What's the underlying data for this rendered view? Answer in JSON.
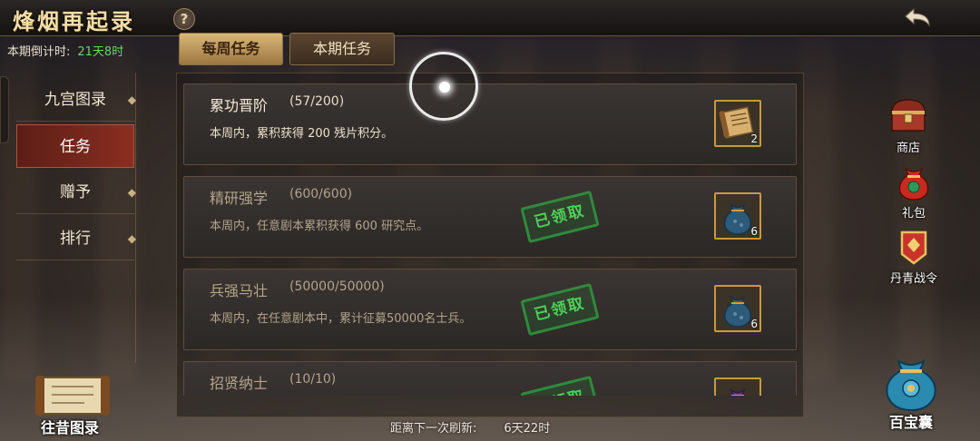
{
  "header": {
    "title": "烽烟再起录",
    "help_label": "?"
  },
  "countdown": {
    "label": "本期倒计时:",
    "value": "21天8时"
  },
  "sidebar": {
    "items": [
      {
        "label": "九宫图录",
        "active": false
      },
      {
        "label": "任务",
        "active": true
      },
      {
        "label": "赠予",
        "active": false
      },
      {
        "label": "排行",
        "active": false
      }
    ]
  },
  "tabs": [
    {
      "label": "每周任务",
      "selected": true
    },
    {
      "label": "本期任务",
      "selected": false
    }
  ],
  "quests": [
    {
      "name": "累功晋阶",
      "progress": "(57/200)",
      "desc": "本周内，累积获得 200 残片积分。",
      "claimed": false,
      "reward_icon": "scroll-icon",
      "reward_count": "2"
    },
    {
      "name": "精研强学",
      "progress": "(600/600)",
      "desc": "本周内，任意剧本累积获得 600 研究点。",
      "claimed": true,
      "reward_icon": "pouch-icon",
      "reward_count": "6"
    },
    {
      "name": "兵强马壮",
      "progress": "(50000/50000)",
      "desc": "本周内，在任意剧本中，累计征募50000名士兵。",
      "claimed": true,
      "reward_icon": "pouch-icon",
      "reward_count": "6"
    },
    {
      "name": "招贤纳士",
      "progress": "(10/10)",
      "desc": "",
      "claimed": true,
      "reward_icon": "purple-pouch-icon",
      "reward_count": ""
    }
  ],
  "stamp_label": "已领取",
  "refresh": {
    "label": "距离下一次刷新:",
    "value": "6天22时"
  },
  "right_menu": [
    {
      "label": "商店",
      "icon": "treasure-chest-icon"
    },
    {
      "label": "礼包",
      "icon": "gift-bag-icon"
    },
    {
      "label": "丹青战令",
      "icon": "battle-order-icon"
    }
  ],
  "corner_left": {
    "label": "往昔图录",
    "icon": "scroll-book-icon"
  },
  "corner_right": {
    "label": "百宝囊",
    "icon": "treasure-pouch-icon"
  },
  "colors": {
    "countdown_value": "#6ed36a",
    "active_sidebar": "#8a2e20",
    "reward_border": "#c89a3a",
    "claimed_stamp": "#2f8a3c"
  }
}
